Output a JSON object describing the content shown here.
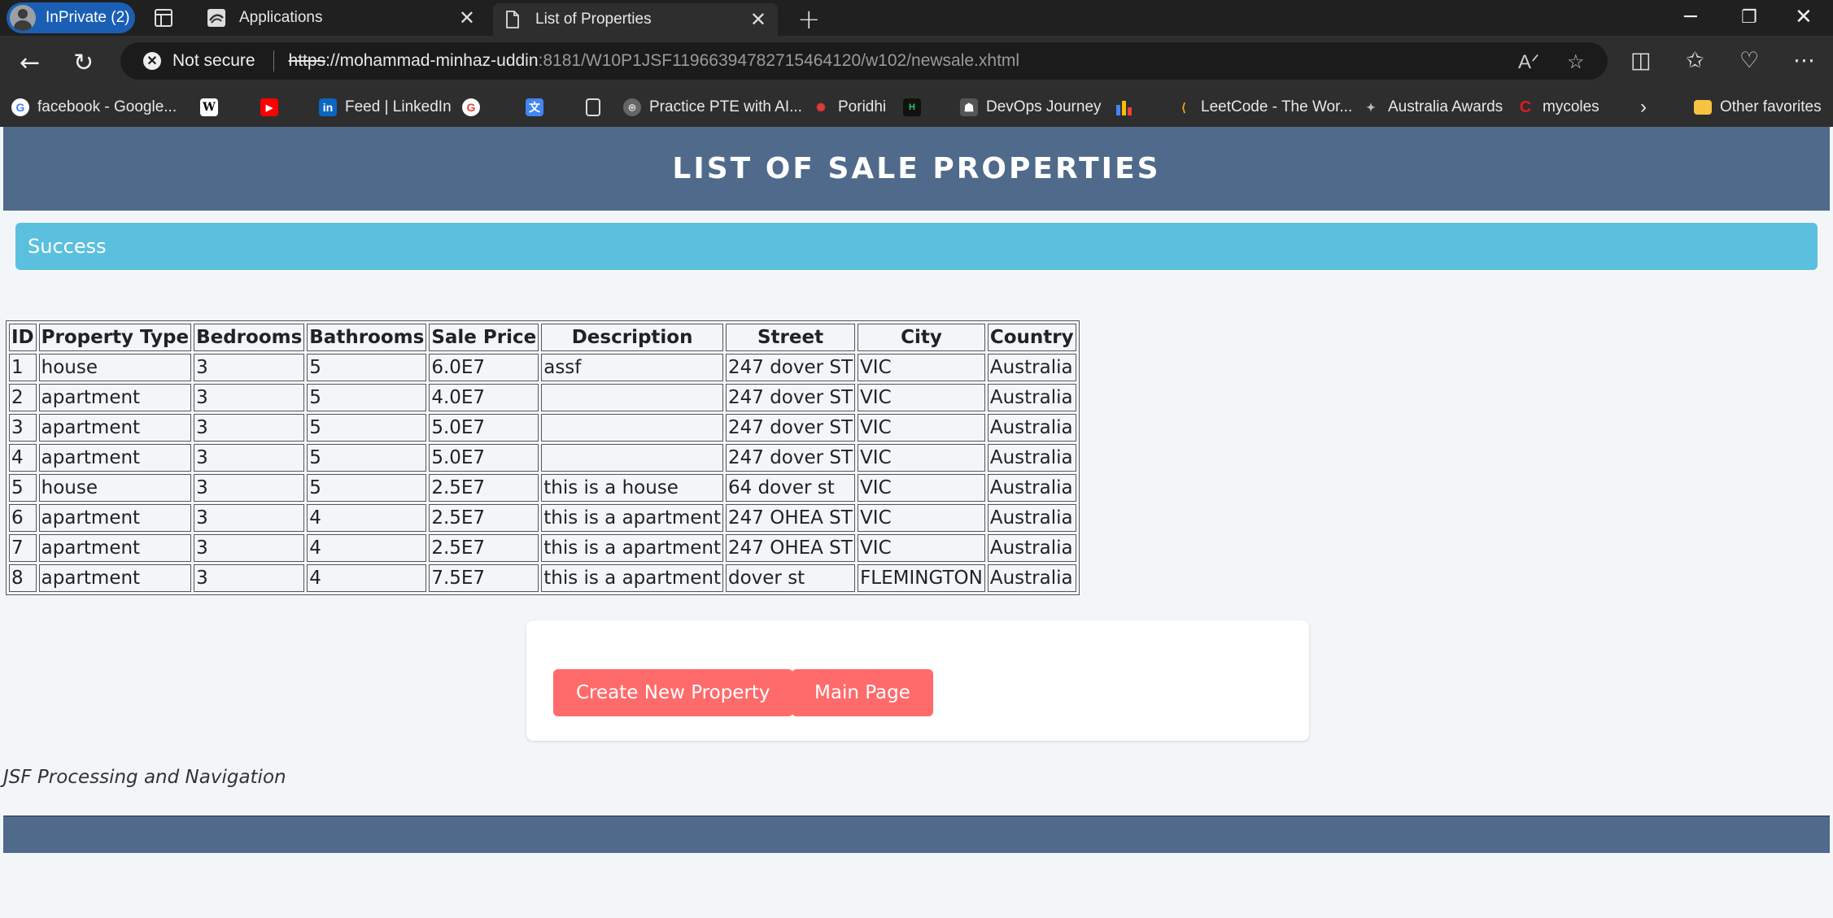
{
  "browser": {
    "profile_label": "InPrivate (2)",
    "tabs": [
      {
        "title": "Applications"
      },
      {
        "title": "List of Properties"
      }
    ],
    "address": {
      "security": "Not secure",
      "scheme": "https",
      "host": "://mohammad-minhaz-uddin",
      "rest": ":8181/W10P1JSF11966394782715464120/w102/newsale.xhtml"
    },
    "bookmarks": [
      {
        "label": "facebook - Google...",
        "icon": "google-icon"
      },
      {
        "label": "",
        "icon": "wikipedia-icon"
      },
      {
        "label": "",
        "icon": "youtube-icon"
      },
      {
        "label": "Feed | LinkedIn",
        "icon": "linkedin-icon"
      },
      {
        "label": "",
        "icon": "google-icon"
      },
      {
        "label": "",
        "icon": "translate-icon"
      },
      {
        "label": "",
        "icon": "page-icon"
      },
      {
        "label": "Practice PTE with AI...",
        "icon": "pte-icon"
      },
      {
        "label": "Poridhi",
        "icon": "poridhi-icon"
      },
      {
        "label": "",
        "icon": "hackerrank-icon"
      },
      {
        "label": "DevOps Journey",
        "icon": "devops-icon"
      },
      {
        "label": "",
        "icon": "chart-icon"
      },
      {
        "label": "LeetCode - The Wor...",
        "icon": "leetcode-icon"
      },
      {
        "label": "Australia Awards",
        "icon": "awards-icon"
      },
      {
        "label": "mycoles",
        "icon": "coles-icon"
      }
    ],
    "other_favorites": "Other favorites"
  },
  "page": {
    "title": "LIST OF SALE PROPERTIES",
    "alert": "Success",
    "table": {
      "headers": [
        "ID",
        "Property Type",
        "Bedrooms",
        "Bathrooms",
        "Sale Price",
        "Description",
        "Street",
        "City",
        "Country"
      ],
      "rows": [
        [
          "1",
          "house",
          "3",
          "5",
          "6.0E7",
          "assf",
          "247 dover ST",
          "VIC",
          "Australia"
        ],
        [
          "2",
          "apartment",
          "3",
          "5",
          "4.0E7",
          "",
          "247 dover ST",
          "VIC",
          "Australia"
        ],
        [
          "3",
          "apartment",
          "3",
          "5",
          "5.0E7",
          "",
          "247 dover ST",
          "VIC",
          "Australia"
        ],
        [
          "4",
          "apartment",
          "3",
          "5",
          "5.0E7",
          "",
          "247 dover ST",
          "VIC",
          "Australia"
        ],
        [
          "5",
          "house",
          "3",
          "5",
          "2.5E7",
          "this is a house",
          "64 dover st",
          "VIC",
          "Australia"
        ],
        [
          "6",
          "apartment",
          "3",
          "4",
          "2.5E7",
          "this is a apartment",
          "247 OHEA ST",
          "VIC",
          "Australia"
        ],
        [
          "7",
          "apartment",
          "3",
          "4",
          "2.5E7",
          "this is a apartment",
          "247 OHEA ST",
          "VIC",
          "Australia"
        ],
        [
          "8",
          "apartment",
          "3",
          "4",
          "7.5E7",
          "this is a apartment",
          "dover st",
          "FLEMINGTON",
          "Australia"
        ]
      ]
    },
    "buttons": {
      "create": "Create New Property",
      "main": "Main Page"
    },
    "footer_text": "JSF Processing and Navigation"
  },
  "colors": {
    "header": "#4f6a8a",
    "alert": "#5bc0de",
    "button": "#ff6b6b"
  }
}
